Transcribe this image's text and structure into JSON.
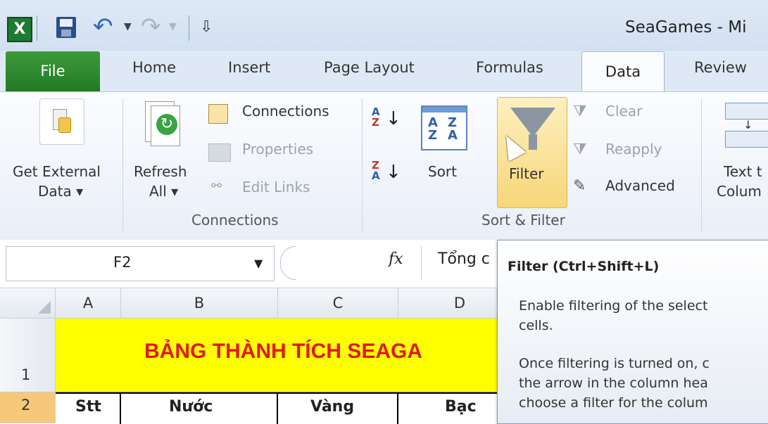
{
  "window": {
    "title": "SeaGames - Mi"
  },
  "quick_access": {
    "customize_glyph": "⇩"
  },
  "tabs": [
    "File",
    "Home",
    "Insert",
    "Page Layout",
    "Formulas",
    "Data",
    "Review"
  ],
  "ribbon": {
    "get_external": {
      "line1": "Get External",
      "line2": "Data ▾"
    },
    "refresh": {
      "line1": "Refresh",
      "line2": "All ▾"
    },
    "connections": {
      "connections": "Connections",
      "properties": "Properties",
      "edit_links": "Edit Links",
      "group": "Connections"
    },
    "sort": {
      "az": "A↓Z",
      "za": "Z↓A",
      "sort": "Sort",
      "filter": "Filter",
      "group": "Sort & Filter"
    },
    "filter_side": {
      "clear": "Clear",
      "reapply": "Reapply",
      "advanced": "Advanced"
    },
    "text_to": {
      "line1": "Text t",
      "line2": "Colum"
    }
  },
  "formula_bar": {
    "name_box": "F2",
    "fx": "fx",
    "content": "Tổng c"
  },
  "columns": [
    "A",
    "B",
    "C",
    "D"
  ],
  "rows": [
    "1",
    "2"
  ],
  "cells": {
    "title": "BẢNG THÀNH TÍCH SEAGA",
    "stt": "Stt",
    "nuoc": "Nước",
    "vang": "Vàng",
    "bac": "Bạc"
  },
  "tooltip": {
    "title": "Filter (Ctrl+Shift+L)",
    "p1a": "Enable filtering of the select",
    "p1b": "cells.",
    "p2a": "Once filtering is turned on, c",
    "p2b": "the arrow in the column hea",
    "p2c": "choose a filter for the colum"
  },
  "colors": {
    "accent_green": "#217a26",
    "title_red": "#e0191e",
    "title_fill": "#ffff00",
    "row_highlight": "#f6c878"
  }
}
